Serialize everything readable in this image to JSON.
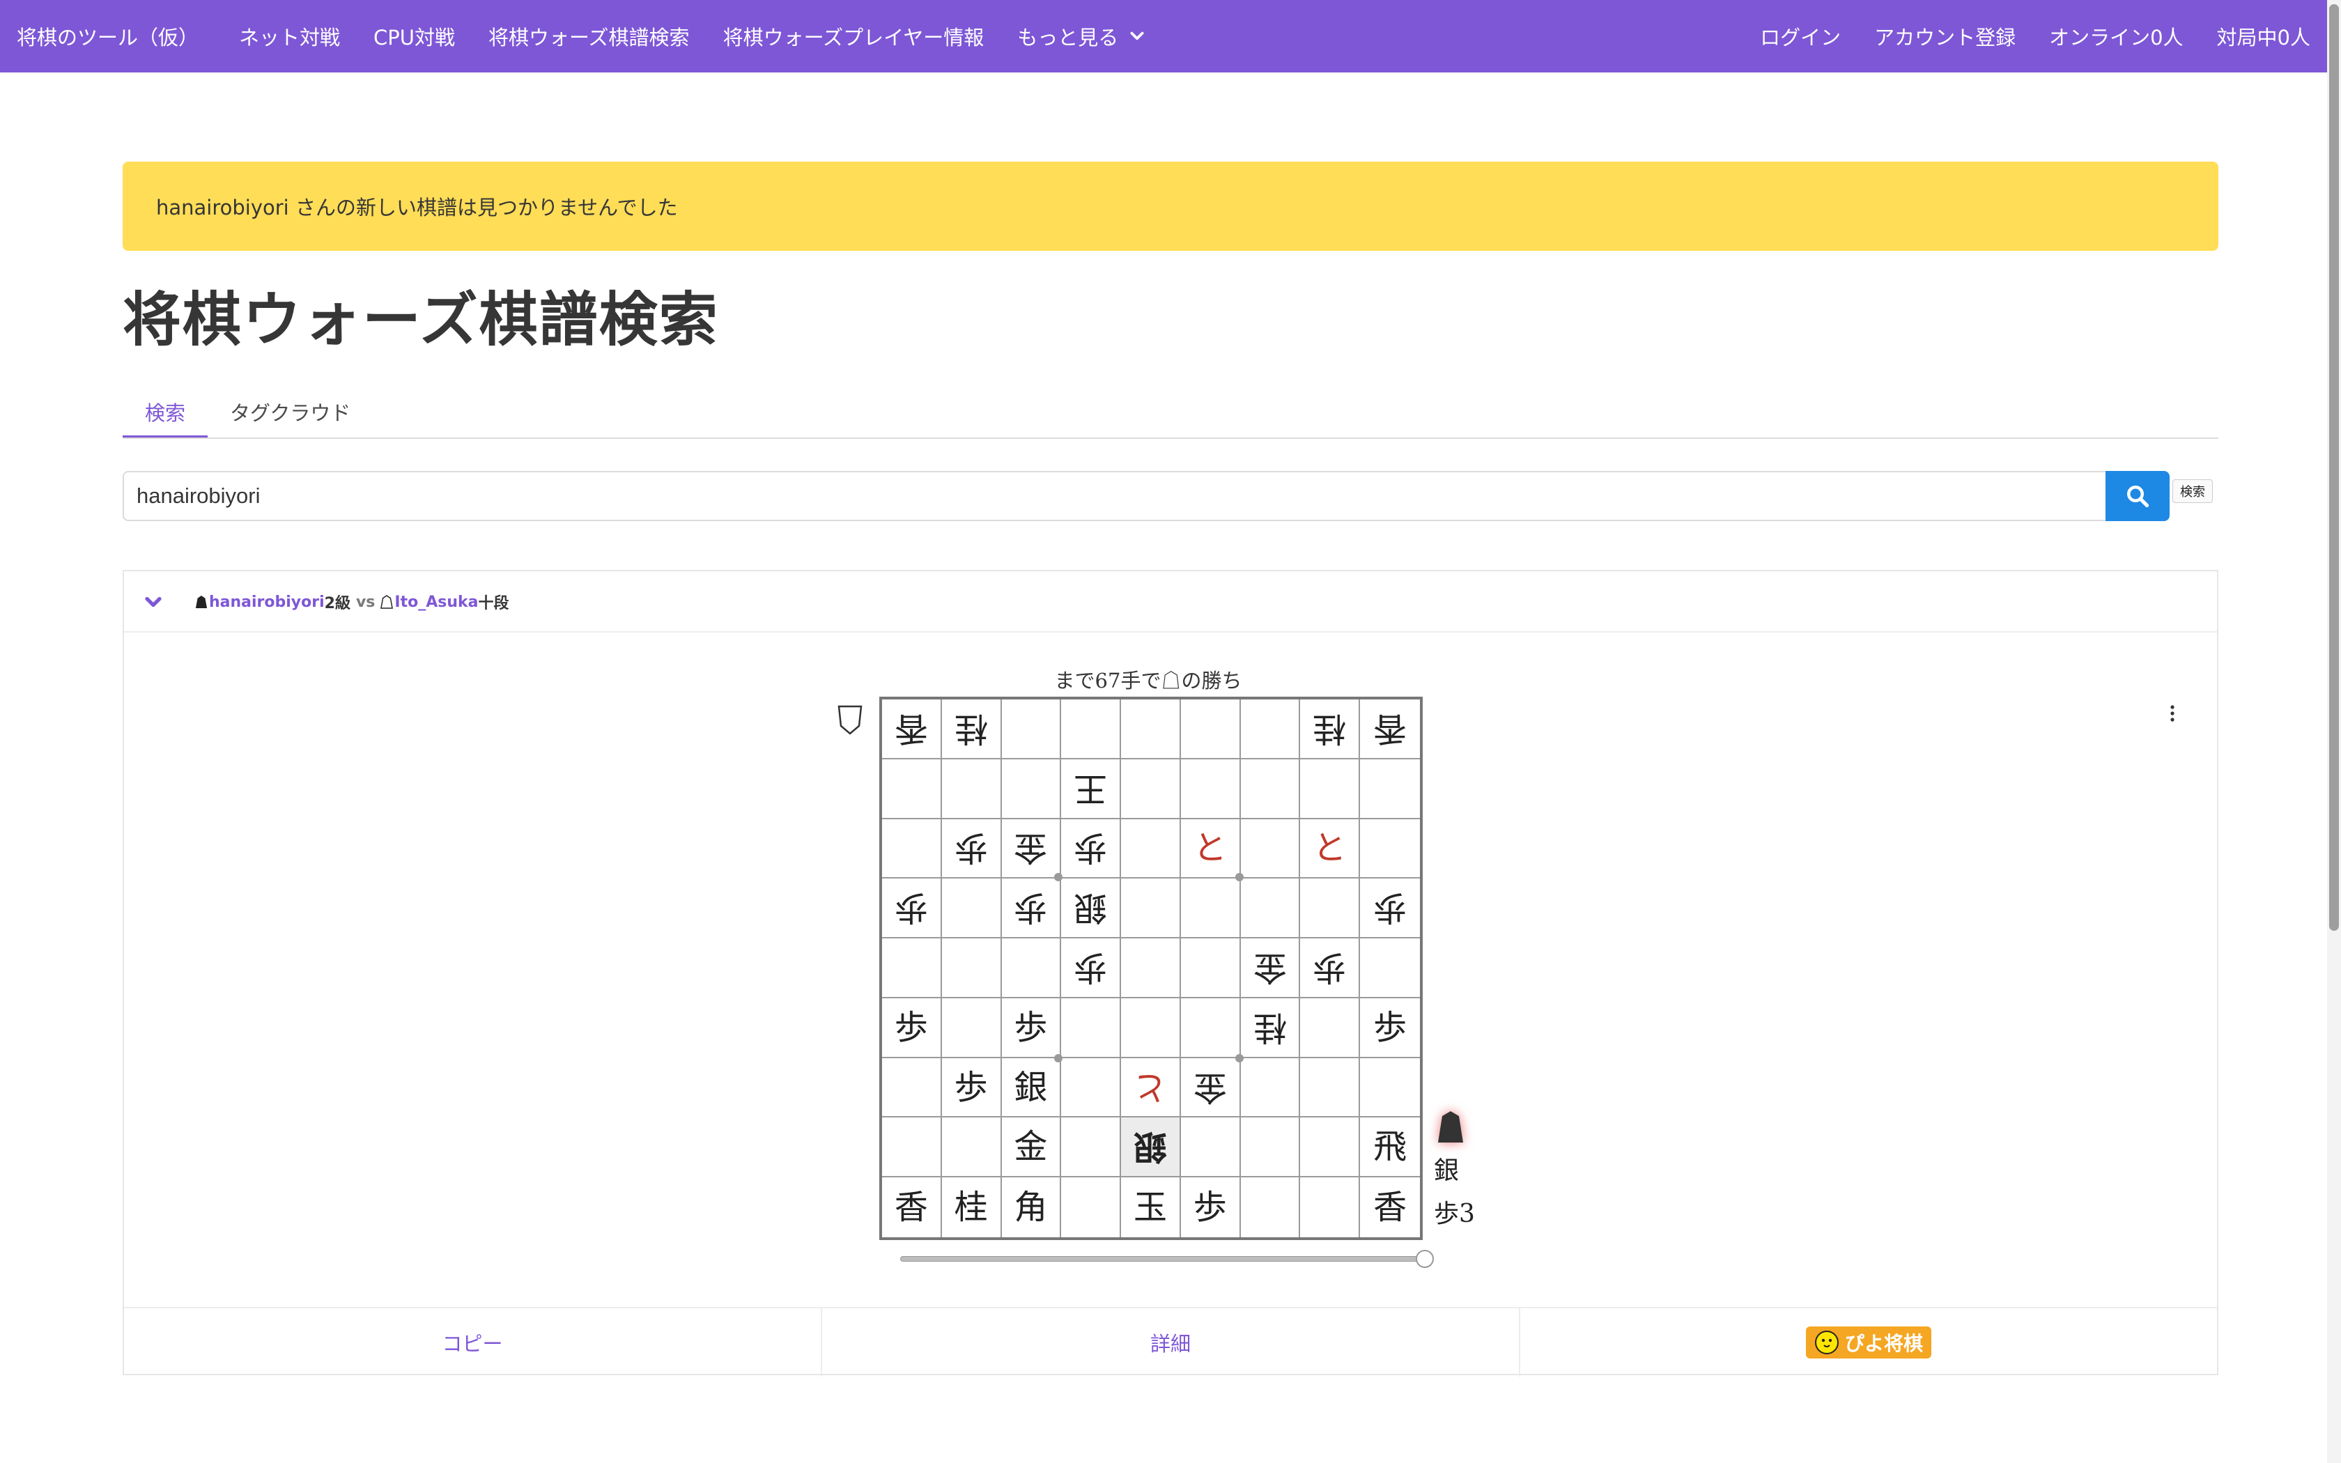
{
  "navbar": {
    "brand": "将棋のツール（仮）",
    "items": [
      "ネット対戦",
      "CPU対戦",
      "将棋ウォーズ棋譜検索",
      "将棋ウォーズプレイヤー情報"
    ],
    "more_label": "もっと見る",
    "right_items": [
      "ログイン",
      "アカウント登録",
      "オンライン0人",
      "対局中0人"
    ]
  },
  "notice": {
    "text": "hanairobiyori さんの新しい棋譜は見つかりませんでした"
  },
  "page_title": "将棋ウォーズ棋譜検索",
  "tabs": [
    {
      "label": "検索",
      "active": true
    },
    {
      "label": "タグクラウド",
      "active": false
    }
  ],
  "search": {
    "value": "hanairobiyori",
    "button_tooltip": "検索"
  },
  "game": {
    "black_player": "hanairobiyori",
    "black_rank": "2級",
    "vs": "vs",
    "white_player": "Ito_Asuka",
    "white_rank": "十段",
    "result": "まで67手で☖の勝ち",
    "board": [
      [
        "v香",
        "v桂",
        "",
        "",
        "",
        "",
        "",
        "v桂",
        "v香"
      ],
      [
        "",
        "",
        "",
        "v王",
        "",
        "",
        "",
        "",
        ""
      ],
      [
        "",
        "v歩",
        "v金",
        "v歩",
        "",
        "+と",
        "",
        "+と",
        ""
      ],
      [
        "v歩",
        "",
        "v歩",
        "v銀",
        "",
        "",
        "",
        "",
        "v歩"
      ],
      [
        "",
        "",
        "",
        "v歩",
        "",
        "",
        "v金",
        "v歩",
        ""
      ],
      [
        "歩",
        "",
        "歩",
        "",
        "",
        "",
        "v桂",
        "",
        "歩"
      ],
      [
        "",
        "歩",
        "銀",
        "",
        "v+と",
        "v金",
        "",
        "",
        ""
      ],
      [
        "",
        "",
        "金",
        "",
        "v銀!",
        "",
        "",
        "",
        "飛"
      ],
      [
        "香",
        "桂",
        "角",
        "",
        "玉",
        "歩",
        "",
        "",
        "香"
      ]
    ],
    "black_hand": [
      "銀",
      "歩3"
    ],
    "white_hand": []
  },
  "footer": {
    "copy_label": "コピー",
    "detail_label": "詳細",
    "piyo_label": "ぴよ将棋"
  },
  "colors": {
    "navbar": "#7e57d6",
    "notice": "#ffdd57",
    "link": "#7e57d6",
    "search_button": "#1e88e5",
    "promoted_piece": "#c0392b"
  }
}
